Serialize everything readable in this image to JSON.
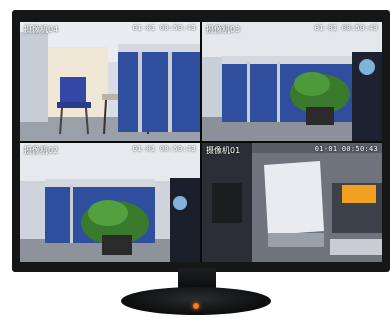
{
  "cameras": [
    {
      "label": "摄像机04",
      "time": "01-01 00:50:43"
    },
    {
      "label": "摄像机03",
      "time": "01-01 00:50:43"
    },
    {
      "label": "摄像机02",
      "time": "01-01 00:50:43"
    },
    {
      "label": "摄像机01",
      "time": "01-01 00:50:43"
    }
  ],
  "colors": {
    "bezel": "#151618",
    "cubicle_blue": "#2f4f9e",
    "power_light": "#ff7a1a"
  }
}
